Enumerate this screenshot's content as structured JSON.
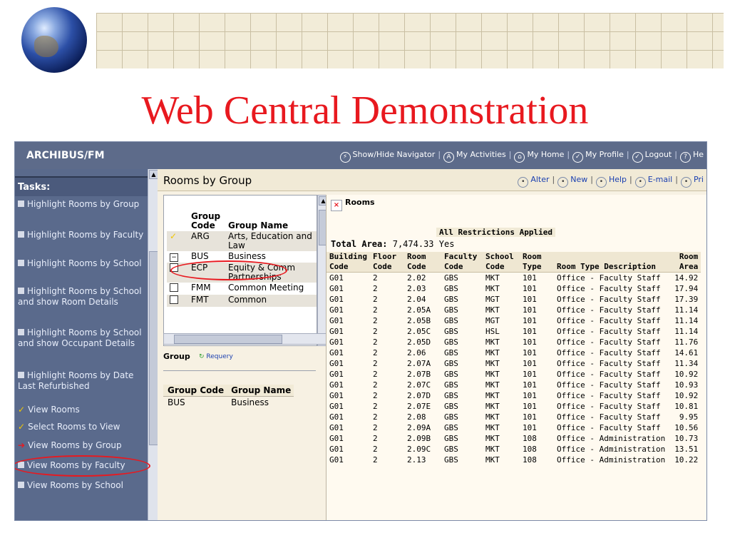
{
  "slide_title": "Web Central Demonstration",
  "app": {
    "logo": "ARCHIBUS/FM",
    "top_links": [
      {
        "icon": "navigator-icon",
        "glyph": "⚡",
        "label": "Show/Hide Navigator"
      },
      {
        "icon": "activities-icon",
        "glyph": "A",
        "label": "My Activities"
      },
      {
        "icon": "home-icon",
        "glyph": "⌂",
        "label": "My Home"
      },
      {
        "icon": "profile-icon",
        "glyph": "✓",
        "label": "My Profile"
      },
      {
        "icon": "logout-icon",
        "glyph": "✓",
        "label": "Logout"
      },
      {
        "icon": "help-icon",
        "glyph": "?",
        "label": "He"
      }
    ]
  },
  "nav": {
    "header": "Tasks:",
    "items": [
      {
        "label": "Highlight Rooms by Group",
        "marker": "icon"
      },
      {
        "label": "Highlight Rooms by Faculty",
        "marker": "icon"
      },
      {
        "label": "Highlight Rooms by School",
        "marker": "icon"
      },
      {
        "label": "Highlight Rooms by School and show Room Details",
        "marker": "icon"
      },
      {
        "label": "Highlight Rooms by School and show Occupant Details",
        "marker": "icon"
      },
      {
        "label": "Highlight Rooms by Date Last Refurbished",
        "marker": "icon"
      },
      {
        "label": "View Rooms",
        "marker": "check"
      },
      {
        "label": "Select Rooms to View",
        "marker": "check"
      },
      {
        "label": "View Rooms by Group",
        "marker": "arrow"
      },
      {
        "label": "View Rooms by Faculty",
        "marker": "icon"
      },
      {
        "label": "View Rooms by School",
        "marker": "icon"
      }
    ]
  },
  "main": {
    "title": "Rooms by Group",
    "links": [
      "Alter",
      "New",
      "Help",
      "E-mail",
      "Pri"
    ]
  },
  "group_list": {
    "headers": [
      "Group Code",
      "Group Name"
    ],
    "rows": [
      {
        "mark": "check",
        "code": "ARG",
        "name": "Arts, Education and Law"
      },
      {
        "mark": "minus",
        "code": "BUS",
        "name": "Business"
      },
      {
        "mark": "box",
        "code": "ECP",
        "name": "Equity & Comm Partnerships"
      },
      {
        "mark": "box",
        "code": "FMM",
        "name": "Common Meeting"
      },
      {
        "mark": "box",
        "code": "FMT",
        "name": "Common"
      }
    ]
  },
  "selection": {
    "header": "Group",
    "requery": "Requery",
    "headers": [
      "Group Code",
      "Group Name"
    ],
    "code": "BUS",
    "name": "Business"
  },
  "rooms": {
    "title": "Rooms",
    "restrictions": "All Restrictions Applied",
    "total_label": "Total Area:",
    "total_value": "7,474.33",
    "total_flag": "Yes",
    "headers": [
      "Building Code",
      "Floor Code",
      "Room Code",
      "Faculty Code",
      "School Code",
      "Room Type",
      "Room Type Description",
      "Room Area"
    ],
    "rows": [
      [
        "G01",
        "2",
        "2.02",
        "GBS",
        "MKT",
        "101",
        "Office - Faculty Staff",
        "14.92"
      ],
      [
        "G01",
        "2",
        "2.03",
        "GBS",
        "MKT",
        "101",
        "Office - Faculty Staff",
        "17.94"
      ],
      [
        "G01",
        "2",
        "2.04",
        "GBS",
        "MGT",
        "101",
        "Office - Faculty Staff",
        "17.39"
      ],
      [
        "G01",
        "2",
        "2.05A",
        "GBS",
        "MKT",
        "101",
        "Office - Faculty Staff",
        "11.14"
      ],
      [
        "G01",
        "2",
        "2.05B",
        "GBS",
        "MGT",
        "101",
        "Office - Faculty Staff",
        "11.14"
      ],
      [
        "G01",
        "2",
        "2.05C",
        "GBS",
        "HSL",
        "101",
        "Office - Faculty Staff",
        "11.14"
      ],
      [
        "G01",
        "2",
        "2.05D",
        "GBS",
        "MKT",
        "101",
        "Office - Faculty Staff",
        "11.76"
      ],
      [
        "G01",
        "2",
        "2.06",
        "GBS",
        "MKT",
        "101",
        "Office - Faculty Staff",
        "14.61"
      ],
      [
        "G01",
        "2",
        "2.07A",
        "GBS",
        "MKT",
        "101",
        "Office - Faculty Staff",
        "11.34"
      ],
      [
        "G01",
        "2",
        "2.07B",
        "GBS",
        "MKT",
        "101",
        "Office - Faculty Staff",
        "10.92"
      ],
      [
        "G01",
        "2",
        "2.07C",
        "GBS",
        "MKT",
        "101",
        "Office - Faculty Staff",
        "10.93"
      ],
      [
        "G01",
        "2",
        "2.07D",
        "GBS",
        "MKT",
        "101",
        "Office - Faculty Staff",
        "10.92"
      ],
      [
        "G01",
        "2",
        "2.07E",
        "GBS",
        "MKT",
        "101",
        "Office - Faculty Staff",
        "10.81"
      ],
      [
        "G01",
        "2",
        "2.08",
        "GBS",
        "MKT",
        "101",
        "Office - Faculty Staff",
        "9.95"
      ],
      [
        "G01",
        "2",
        "2.09A",
        "GBS",
        "MKT",
        "101",
        "Office - Faculty Staff",
        "10.56"
      ],
      [
        "G01",
        "2",
        "2.09B",
        "GBS",
        "MKT",
        "108",
        "Office - Administration",
        "10.73"
      ],
      [
        "G01",
        "2",
        "2.09C",
        "GBS",
        "MKT",
        "108",
        "Office - Administration",
        "13.51"
      ],
      [
        "G01",
        "2",
        "2.13",
        "GBS",
        "MKT",
        "108",
        "Office - Administration",
        "10.22"
      ]
    ]
  },
  "colors": {
    "title_red": "#e8191f",
    "nav_bg": "#5a6a8c",
    "header_bar": "#5d6b8a",
    "panel_bg": "#f7f1e3"
  }
}
